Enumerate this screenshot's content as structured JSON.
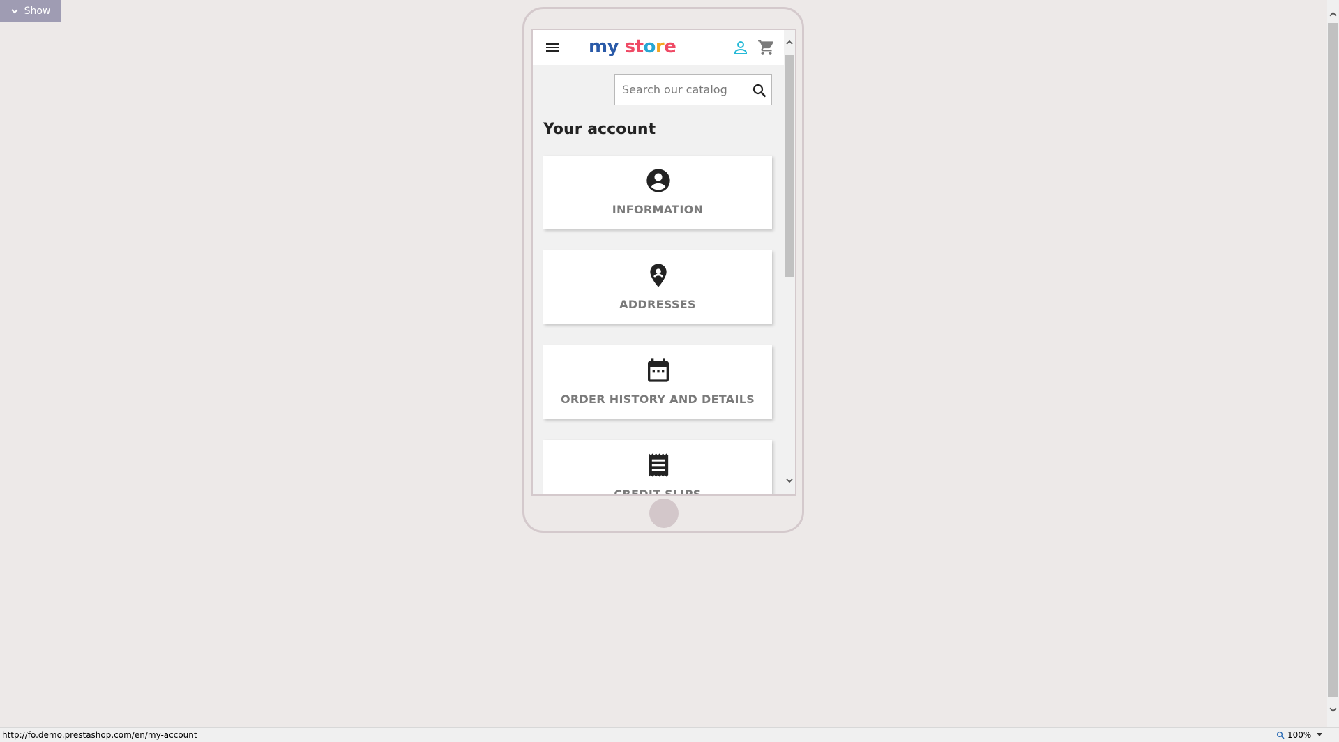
{
  "toggle": {
    "label": "Show",
    "icon": "chevron-down-icon"
  },
  "header": {
    "logo": {
      "part1": "my",
      "part2": "st",
      "part3": "o",
      "part4": "r",
      "part5": "e"
    },
    "icons": [
      "menu-icon",
      "user-icon",
      "cart-icon"
    ]
  },
  "search": {
    "placeholder": "Search our catalog",
    "value": "",
    "icon": "search-icon"
  },
  "page": {
    "title": "Your account"
  },
  "tiles": [
    {
      "label": "INFORMATION",
      "icon": "account-circle-icon"
    },
    {
      "label": "ADDRESSES",
      "icon": "location-pin-icon"
    },
    {
      "label": "ORDER HISTORY AND DETAILS",
      "icon": "calendar-icon"
    },
    {
      "label": "CREDIT SLIPS",
      "icon": "receipt-icon"
    }
  ],
  "statusbar": {
    "url": "http://fo.demo.prestashop.com/en/my-account",
    "zoom": "100%"
  },
  "colors": {
    "accent": "#24b9d7",
    "tile_text": "#7a7a7a",
    "background": "#ede9e8"
  }
}
